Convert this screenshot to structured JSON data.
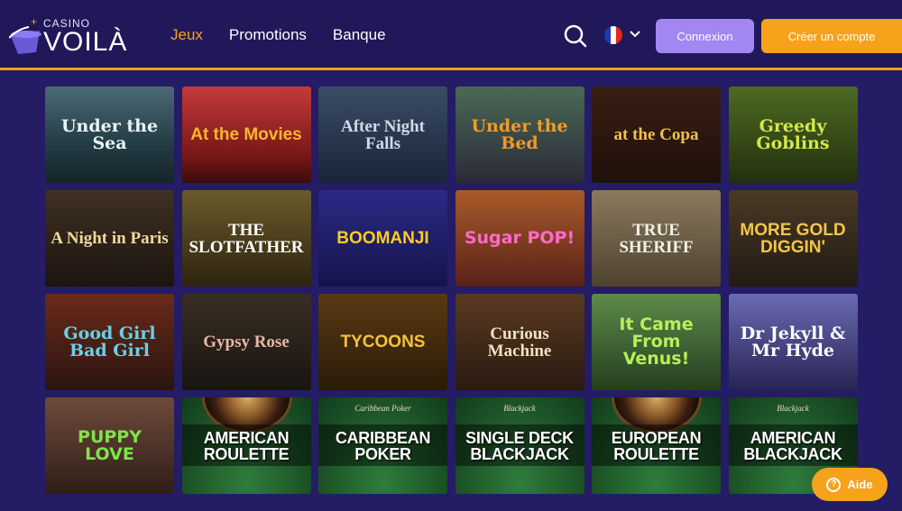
{
  "brand": {
    "casino": "CASINO",
    "voila": "VOILÀ",
    "spark": "+"
  },
  "nav": {
    "items": [
      {
        "label": "Jeux",
        "active": true
      },
      {
        "label": "Promotions",
        "active": false
      },
      {
        "label": "Banque",
        "active": false
      }
    ]
  },
  "header": {
    "search_icon": "search-icon",
    "language": {
      "flag": "fr",
      "flag_colors": [
        "#1f3bb3",
        "#ffffff",
        "#e1261c"
      ]
    },
    "login_label": "Connexion",
    "register_label": "Créer un compte"
  },
  "colors": {
    "accent": "#f7a21b",
    "login": "#a286f2",
    "background": "#241c64"
  },
  "games": [
    {
      "title": "Under the Sea",
      "bg": "linear-gradient(180deg,#4c6a74 0%,#233c46 60%,#15242a 100%)",
      "color": "#eaf4f6",
      "font": "\"DejaVu Serif\", serif"
    },
    {
      "title": "At the Movies",
      "bg": "linear-gradient(180deg,#c43a3a 0%,#7a1818 70%,#3a0b0b 100%)",
      "color": "#ffb52e",
      "font": "\"Liberation Sans\", sans-serif"
    },
    {
      "title": "After Night Falls",
      "bg": "linear-gradient(180deg,#3a4c66 0%,#1a2438 100%)",
      "color": "#cfd9e8",
      "font": "\"Liberation Serif\", serif"
    },
    {
      "title": "Under the Bed",
      "bg": "linear-gradient(180deg,#4a6a54 0%,#2a2a38 100%)",
      "color": "#f19a2a",
      "font": "\"DejaVu Serif\", serif"
    },
    {
      "title": "at the Copa",
      "bg": "linear-gradient(180deg,#3a1e14 0%,#1e100a 100%)",
      "color": "#f2c24e",
      "font": "\"Liberation Serif\", serif"
    },
    {
      "title": "Greedy Goblins",
      "bg": "linear-gradient(180deg,#4e6a22 0%,#23300e 100%)",
      "color": "#d3e84a",
      "font": "\"DejaVu Serif\", serif"
    },
    {
      "title": "A Night in Paris",
      "bg": "linear-gradient(180deg,#3e3024 0%,#1c140e 100%)",
      "color": "#f0d8a0",
      "font": "\"Liberation Serif\", serif"
    },
    {
      "title": "THE SLOTFATHER",
      "bg": "linear-gradient(180deg,#6a5a2a 0%,#2e2410 100%)",
      "color": "#ffffff",
      "font": "\"Liberation Serif\", serif"
    },
    {
      "title": "BOOMANJI",
      "bg": "linear-gradient(180deg,#2a2a88 0%,#14144a 100%)",
      "color": "#ffcc22",
      "font": "\"Liberation Sans\", sans-serif"
    },
    {
      "title": "Sugar POP!",
      "bg": "linear-gradient(180deg,#a85a2a 0%,#5a2218 100%)",
      "color": "#ff6ac8",
      "font": "\"DejaVu Sans\", sans-serif"
    },
    {
      "title": "TRUE SHERIFF",
      "bg": "linear-gradient(180deg,#8a7a5e 0%,#4e4230 100%)",
      "color": "#f4f0e6",
      "font": "\"Liberation Serif\", serif"
    },
    {
      "title": "MORE GOLD DIGGIN'",
      "bg": "linear-gradient(180deg,#4a3a26 0%,#221a12 100%)",
      "color": "#f3c64a",
      "font": "\"Liberation Sans\", sans-serif"
    },
    {
      "title": "Good Girl Bad Girl",
      "bg": "linear-gradient(180deg,#6a2a1a 0%,#2a1410 100%)",
      "color": "#6ad0e8",
      "font": "\"DejaVu Serif\", serif"
    },
    {
      "title": "Gypsy Rose",
      "bg": "linear-gradient(180deg,#3a2e24 0%,#181410 100%)",
      "color": "#e7b8a8",
      "font": "\"Liberation Serif\", serif"
    },
    {
      "title": "TYCOONS",
      "bg": "linear-gradient(180deg,#5a3a14 0%,#2a1a08 100%)",
      "color": "#f5c23a",
      "font": "\"Liberation Sans\", sans-serif"
    },
    {
      "title": "Curious Machine",
      "bg": "linear-gradient(180deg,#5a3a22 0%,#2a1a10 100%)",
      "color": "#efe2c2",
      "font": "\"Liberation Serif\", serif"
    },
    {
      "title": "It Came From Venus!",
      "bg": "linear-gradient(180deg,#5e8a4a 0%,#243e20 100%)",
      "color": "#b6ef5a",
      "font": "\"DejaVu Sans\", sans-serif"
    },
    {
      "title": "Dr Jekyll & Mr Hyde",
      "bg": "linear-gradient(180deg,#6a6ab4 0%,#262452 100%)",
      "color": "#ffffff",
      "font": "\"DejaVu Serif\", serif"
    },
    {
      "title": "PUPPY LOVE",
      "bg": "linear-gradient(180deg,#6e4a3a 0%,#2e1e18 100%)",
      "color": "#7fe34a",
      "font": "\"DejaVu Sans\", sans-serif"
    }
  ],
  "table_games": [
    {
      "title": "AMERICAN ROULETTE",
      "sub": "",
      "wheel": true
    },
    {
      "title": "CARIBBEAN POKER",
      "sub": "Caribbean Poker",
      "wheel": false
    },
    {
      "title": "SINGLE DECK BLACKJACK",
      "sub": "Blackjack",
      "wheel": false
    },
    {
      "title": "EUROPEAN ROULETTE",
      "sub": "",
      "wheel": true
    },
    {
      "title": "AMERICAN BLACKJACK",
      "sub": "Blackjack",
      "wheel": false
    }
  ],
  "help": {
    "label": "Aide",
    "icon": "question-icon"
  }
}
